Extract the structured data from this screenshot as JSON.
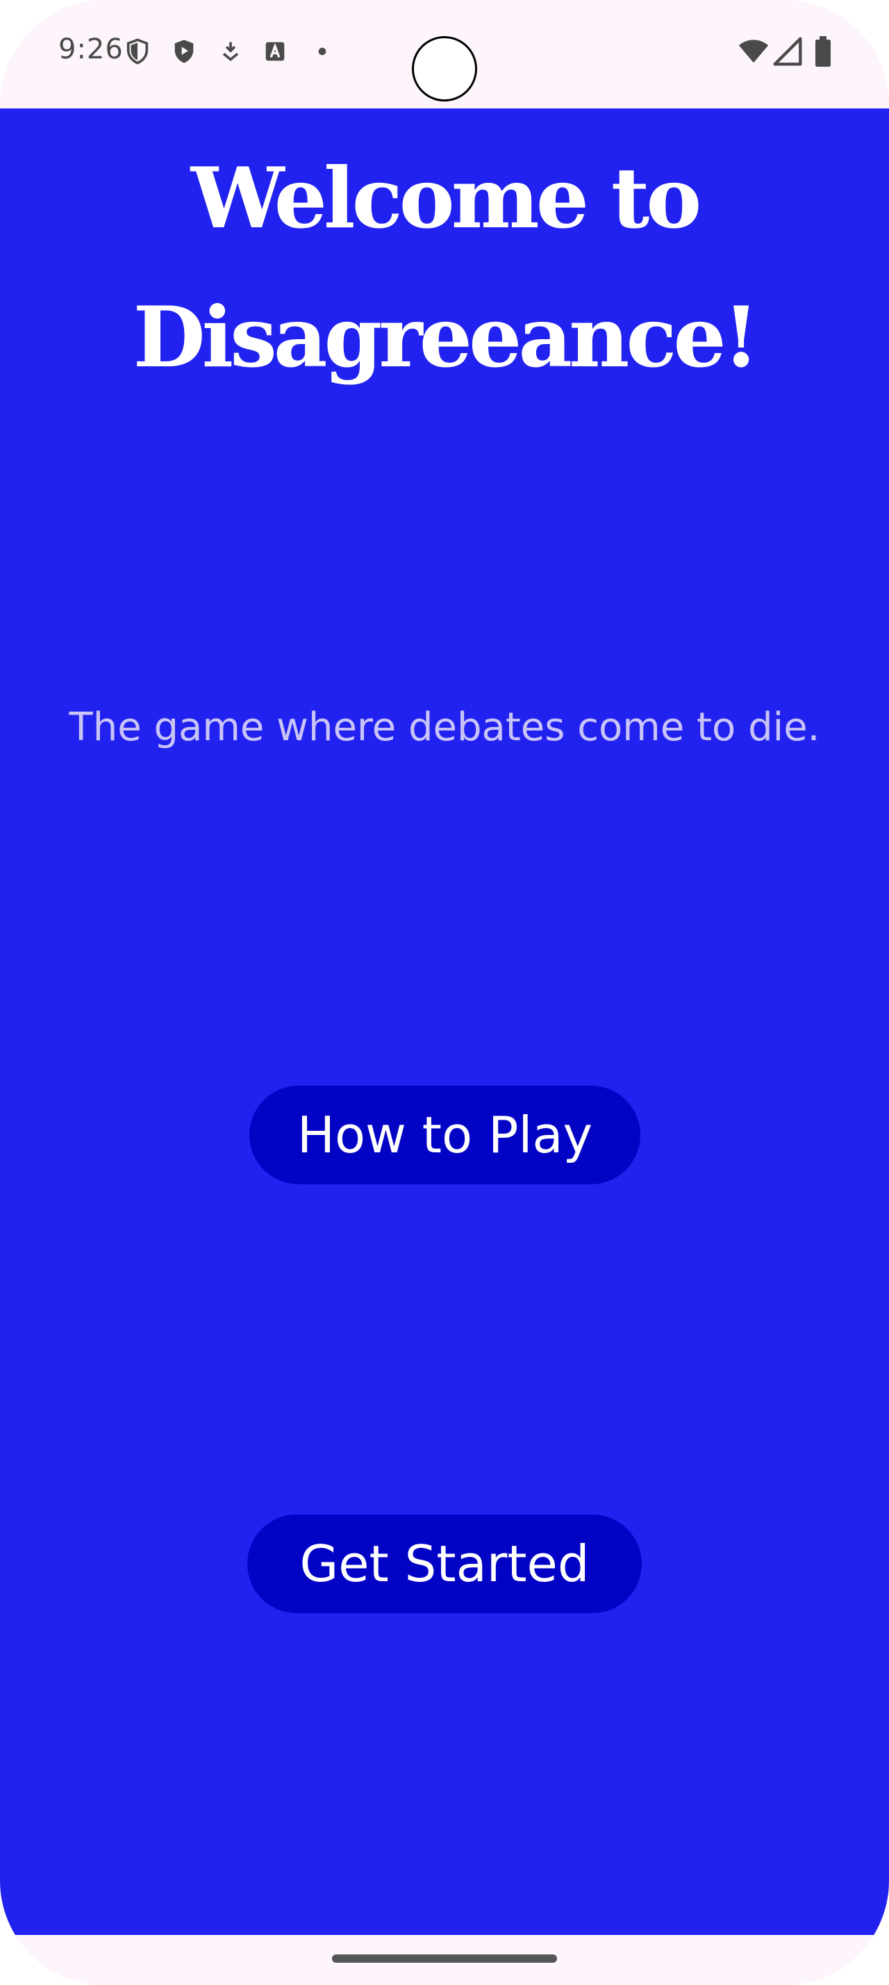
{
  "status_bar": {
    "time": "9:26",
    "icons": [
      "vpn-shield-icon",
      "play-store-icon",
      "download-icon",
      "font-app-icon",
      "dot-icon",
      "wifi-icon",
      "signal-icon",
      "battery-icon"
    ]
  },
  "app": {
    "title_line1": "Welcome to",
    "title_line2": "Disagreeance!",
    "subtitle": "The game where debates come to die.",
    "how_to_play_label": "How to Play",
    "get_started_label": "Get Started"
  },
  "colors": {
    "background": "#2222f0",
    "button": "#0303c6",
    "title_text": "#ffffff",
    "subtitle_text": "#c9c4f8",
    "system_bars": "#fdf5fb"
  }
}
